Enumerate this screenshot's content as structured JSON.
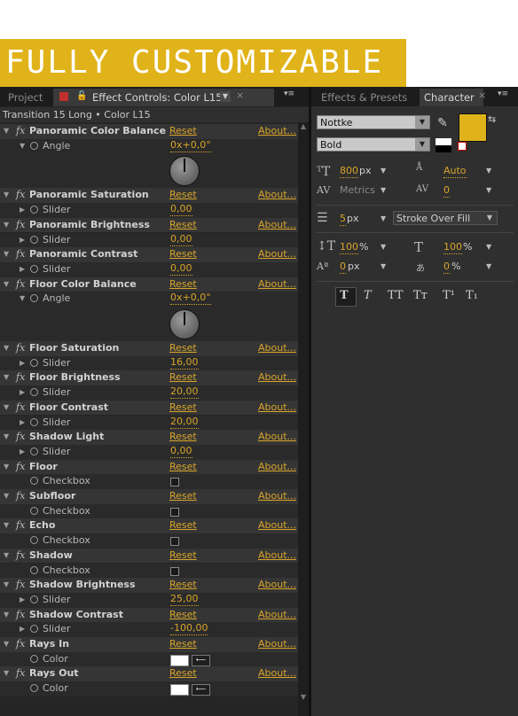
{
  "banner": {
    "text": "FULLY CUSTOMIZABLE"
  },
  "left_panel": {
    "tabs": {
      "project": "Project",
      "effect_controls": "Effect Controls: Color L15"
    },
    "subtitle": "Transition 15 Long • Color L15"
  },
  "labels": {
    "fx": "fx",
    "reset": "Reset",
    "about": "About..."
  },
  "effects": [
    {
      "name": "Panoramic Color Balance",
      "prop": "Angle",
      "value": "0x+0,0°",
      "control": "knob",
      "expanded": true
    },
    {
      "name": "Panoramic Saturation",
      "prop": "Slider",
      "value": "0,00",
      "control": "value"
    },
    {
      "name": "Panoramic Brightness",
      "prop": "Slider",
      "value": "0,00",
      "control": "value"
    },
    {
      "name": "Panoramic Contrast",
      "prop": "Slider",
      "value": "0,00",
      "control": "value"
    },
    {
      "name": "Floor Color Balance",
      "prop": "Angle",
      "value": "0x+0,0°",
      "control": "knob",
      "expanded": true
    },
    {
      "name": "Floor Saturation",
      "prop": "Slider",
      "value": "16,00",
      "control": "value"
    },
    {
      "name": "Floor Brightness",
      "prop": "Slider",
      "value": "20,00",
      "control": "value"
    },
    {
      "name": "Floor Contrast",
      "prop": "Slider",
      "value": "20,00",
      "control": "value"
    },
    {
      "name": "Shadow Light",
      "prop": "Slider",
      "value": "0,00",
      "control": "value"
    },
    {
      "name": "Floor",
      "prop": "Checkbox",
      "value": "",
      "control": "checkbox"
    },
    {
      "name": "Subfloor",
      "prop": "Checkbox",
      "value": "",
      "control": "checkbox"
    },
    {
      "name": "Echo",
      "prop": "Checkbox",
      "value": "",
      "control": "checkbox"
    },
    {
      "name": "Shadow",
      "prop": "Checkbox",
      "value": "",
      "control": "checkbox"
    },
    {
      "name": "Shadow Brightness",
      "prop": "Slider",
      "value": "25,00",
      "control": "value"
    },
    {
      "name": "Shadow Contrast",
      "prop": "Slider",
      "value": "-100,00",
      "control": "value"
    },
    {
      "name": "Rays In",
      "prop": "Color",
      "value": "",
      "control": "color"
    },
    {
      "name": "Rays Out",
      "prop": "Color",
      "value": "",
      "control": "color"
    }
  ],
  "character": {
    "tabs": {
      "effects_presets": "Effects & Presets",
      "character": "Character"
    },
    "font_family": "Nottke",
    "font_style": "Bold",
    "font_size": "800",
    "font_size_unit": "px",
    "leading": "Auto",
    "kerning": "Metrics",
    "tracking": "0",
    "stroke_width": "5",
    "stroke_unit": "px",
    "stroke_mode": "Stroke Over Fill",
    "vertical_scale": "100",
    "horizontal_scale": "100",
    "pct": "%",
    "baseline_shift": "0",
    "tsume": "0",
    "fill_color": "#e0b31a",
    "style_buttons": [
      "T",
      "T",
      "TT",
      "Tт",
      "T¹",
      "T₁"
    ]
  },
  "colors": {
    "accent": "#d9a52a",
    "banner": "#e0b31a"
  }
}
